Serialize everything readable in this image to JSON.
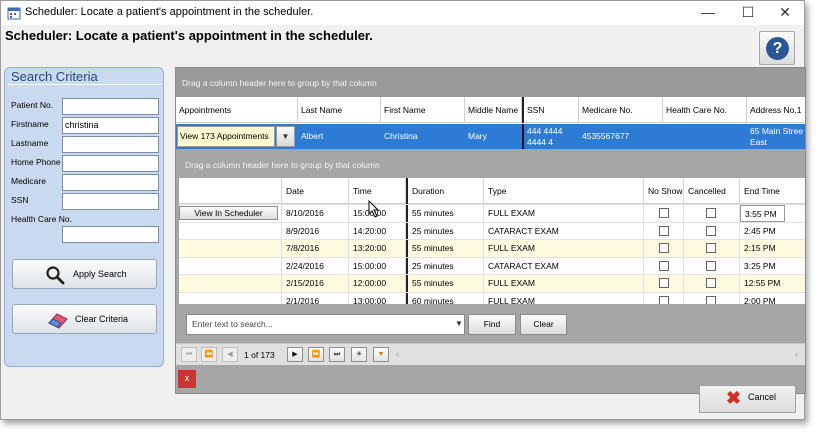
{
  "window": {
    "title": "Scheduler: Locate a patient's appointment in the scheduler.",
    "minimize_glyph": "—",
    "maximize_glyph": "☐",
    "close_glyph": "✕"
  },
  "page": {
    "heading": "Scheduler: Locate a patient's appointment in the scheduler.",
    "help_glyph": "?"
  },
  "search_criteria": {
    "title": "Search Criteria",
    "fields": [
      {
        "label": "Patient No.",
        "value": ""
      },
      {
        "label": "Firstname",
        "value": "christina"
      },
      {
        "label": "Lastname",
        "value": ""
      },
      {
        "label": "Home Phone",
        "value": ""
      },
      {
        "label": "Medicare",
        "value": ""
      },
      {
        "label": "SSN",
        "value": ""
      },
      {
        "label": "Health Care No.",
        "value": ""
      }
    ],
    "apply_label": "Apply Search",
    "clear_label": "Clear Criteria"
  },
  "grid": {
    "group_hint": "Drag a column header here to group by that column",
    "columns": [
      "Appointments",
      "Last Name",
      "First Name",
      "Middle Name",
      "SSN",
      "Medicare No.",
      "Health Care No.",
      "Address No.1"
    ],
    "master_row": {
      "appointments": "View 173 Appointments",
      "last_name": "Albert",
      "first_name": "Christina",
      "middle_name": "Mary",
      "ssn_line1": "444 4444",
      "ssn_line2": "4444 4",
      "medicare": "4535567677",
      "health_care": "",
      "address_line1": "65 Main Stree",
      "address_line2": "East"
    }
  },
  "detail": {
    "group_hint": "Drag a column header here to group by that column",
    "columns": [
      "",
      "Date",
      "Time",
      "Duration",
      "Type",
      "No Show",
      "Cancelled",
      "End Time"
    ],
    "view_button_label": "View In Scheduler",
    "rows": [
      {
        "date": "8/10/2016",
        "time": "15:00:00",
        "duration": "55 minutes",
        "type": "FULL EXAM",
        "no_show": false,
        "cancelled": false,
        "end": "3:55 PM"
      },
      {
        "date": "8/9/2016",
        "time": "14:20:00",
        "duration": "25 minutes",
        "type": "CATARACT EXAM",
        "no_show": false,
        "cancelled": false,
        "end": "2:45 PM"
      },
      {
        "date": "7/8/2016",
        "time": "13:20:00",
        "duration": "55 minutes",
        "type": "FULL EXAM",
        "no_show": false,
        "cancelled": false,
        "end": "2:15 PM"
      },
      {
        "date": "2/24/2016",
        "time": "15:00:00",
        "duration": "25 minutes",
        "type": "CATARACT EXAM",
        "no_show": false,
        "cancelled": false,
        "end": "3:25 PM"
      },
      {
        "date": "2/15/2016",
        "time": "12:00:00",
        "duration": "55 minutes",
        "type": "FULL EXAM",
        "no_show": false,
        "cancelled": false,
        "end": "12:55 PM"
      },
      {
        "date": "2/1/2016",
        "time": "13:00:00",
        "duration": "60 minutes",
        "type": "FULL EXAM",
        "no_show": false,
        "cancelled": false,
        "end": "2:00 PM"
      }
    ],
    "search_placeholder": "Enter text to search...",
    "find_label": "Find",
    "clear_label": "Clear",
    "pager_text": "1 of 173",
    "close_glyph": "x"
  },
  "footer": {
    "cancel_label": "Cancel"
  },
  "colors": {
    "selection": "#2e7bd6",
    "panel": "#c9daf0",
    "group_bar": "#9a9a9a",
    "alt_row": "#fffbe0"
  }
}
